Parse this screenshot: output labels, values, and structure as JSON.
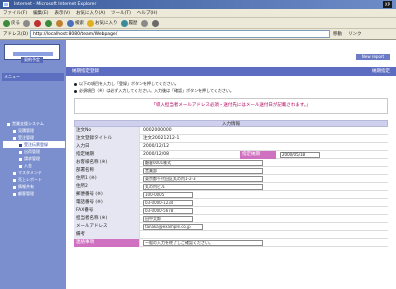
{
  "window": {
    "title": "Internet - Microsoft Internet Explorer",
    "logo": "XP"
  },
  "menu": [
    "ファイル(F)",
    "編集(E)",
    "表示(V)",
    "お気に入り(A)",
    "ツール(T)",
    "ヘルプ(H)"
  ],
  "toolbar": {
    "back": "戻る",
    "search": "検索",
    "favorites": "お気に入り",
    "history": "履歴"
  },
  "address": {
    "label": "アドレス(D)",
    "url": "http://localhost:8080/team/Webpage/",
    "go": "移動",
    "links": "リンク"
  },
  "sidebar": {
    "button": "契約予定",
    "header": "メニュー",
    "items": [
      {
        "label": "営業支援システム",
        "level": 1
      },
      {
        "label": "見積管理",
        "level": 2
      },
      {
        "label": "受注管理",
        "level": 2
      },
      {
        "label": "受注伝票登録",
        "level": 3,
        "selected": true
      },
      {
        "label": "出荷管理",
        "level": 3
      },
      {
        "label": "請求管理",
        "level": 3
      },
      {
        "label": "入金",
        "level": 3
      },
      {
        "label": "マスタメンテ",
        "level": 2
      },
      {
        "label": "売上レポート",
        "level": 2
      },
      {
        "label": "情報共有",
        "level": 2
      },
      {
        "label": "顧客管理",
        "level": 2
      }
    ]
  },
  "main": {
    "top_button": "New report",
    "header_left": "納期指定登録",
    "header_right": "納期指定",
    "notes": [
      "以下の項目を入力し「登録」ボタンを押してください。",
      "必須項目（※）は必ず入力してください。入力後は「確認」ボタンを押してください。"
    ],
    "notice": "「導入担当者メールアドレス必須・送付先にはメール送付日が記載されます。」",
    "form_title": "入力情報",
    "rows": [
      {
        "label": "注文No",
        "value": "0002000000"
      },
      {
        "label": "注文登録タイトル",
        "value": "注文20021212-1"
      },
      {
        "label": "入力日",
        "value": "2000/12/12"
      },
      {
        "label": "指定納期",
        "value": "2000/12/08",
        "extra_label": "指定納期",
        "extra_value": "2000/05/18"
      },
      {
        "label": "お客様名称 (※)",
        "input": "顧客0001株式"
      },
      {
        "label": "部署名称",
        "input": "営業部"
      },
      {
        "label": "住所1 (※)",
        "input": "東京都千代田区丸の内1-2-3"
      },
      {
        "label": "住所2",
        "input": "丸の内ビル"
      },
      {
        "label": "郵便番号 (※)",
        "input": "100-0005"
      },
      {
        "label": "電話番号 (※)",
        "input": "03-0000-1234"
      },
      {
        "label": "FAX番号",
        "input": "03-0000-5678"
      },
      {
        "label": "担当者名称 (※)",
        "input": "田中太郎"
      },
      {
        "label": "メールアドレス",
        "input": "tanaka@example.co.jp"
      },
      {
        "label": "備考",
        "input": ""
      },
      {
        "label": "連絡事項",
        "input": "一般の入力を終了しご確認ください。",
        "emph": true
      }
    ]
  }
}
